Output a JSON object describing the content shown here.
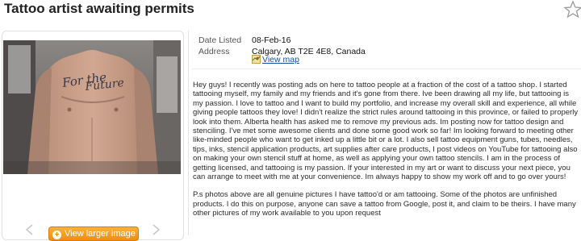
{
  "listing": {
    "title": "Tattoo artist awaiting permits"
  },
  "details": {
    "date_label": "Date Listed",
    "date_value": "08-Feb-16",
    "address_label": "Address",
    "address_value": "Calgary, AB T2E 4E8, Canada",
    "map_link": "View map"
  },
  "gallery": {
    "larger_image_button": "View larger image"
  },
  "description": {
    "paragraph_1": "Hey guys! I recently was posting ads on here to tattoo people at a fraction of the cost of a tattoo shop. I started tattooing myself, my family and my friends and it's gone from there. Ive been drawing all my life, but tattooing is my passion. I love to tattoo and I want to build my portfolio, and increase my overall skill and experience, all while giving people tattoos they love! I didn't realize the strict rules around tattooing in this province, or failed to properly look into them. Alberta health has asked me to remove my previous ads. Im posting now for tattoo design and stenciling. I've met some awesome clients and done some good work so far! Im looking forward to meeting other like-minded people who want to get inked up a little bit or a lot. I also sell tattoo equipment guns, tubes, needles, tips, inks, stencil application products, art supplies after care products, I post videos on YouTube for tattooing also on making your own stencil stuff at home, as well as applying your own tattoo stencils. I am in the process of getting licensed, and tattooing is my passion. If your interested in my art or want to discuss your next piece, you can arrange to meet with me at your convenience. Im always happy to show my work off and to go over yours!",
    "paragraph_2": "P.s photos above are all genuine pictures I have tattoo'd or am tattooing. Some of the photos are unfinished products. I do this on purpose, anyone can save a tattoo from Google, post it, and claim to be theirs. I have many other pictures of my work available to you upon request"
  },
  "icons": {
    "favorite": "star-icon",
    "map": "map-icon",
    "prev": "chevron-left-icon",
    "next": "chevron-right-icon",
    "enlarge": "plus-icon"
  },
  "colors": {
    "button_orange": "#f39a1b",
    "link_blue": "#1a4f9c"
  }
}
